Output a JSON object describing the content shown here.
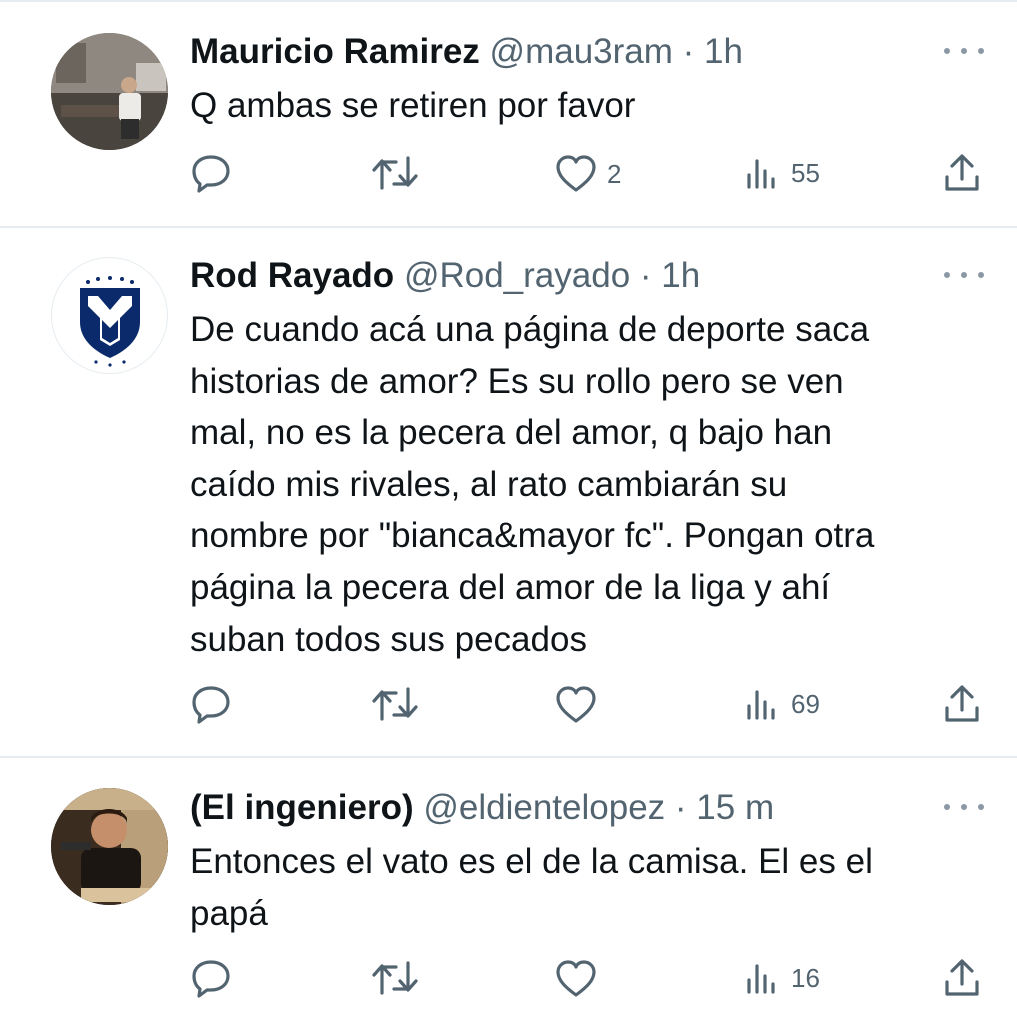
{
  "tweets": [
    {
      "author": {
        "name": "Mauricio Ramirez",
        "handle": "@mau3ram",
        "separator": "·",
        "time": "1h"
      },
      "text": "Q ambas se retiren por favor",
      "stats": {
        "replies": "",
        "retweets": "",
        "likes": "2",
        "views": "55"
      }
    },
    {
      "author": {
        "name": "Rod Rayado",
        "handle": "@Rod_rayado",
        "separator": "·",
        "time": "1h"
      },
      "text_lines": [
        "De cuando acá una página de deporte saca",
        "historias de amor? Es su rollo pero se ven",
        "mal, no es la pecera del amor, q bajo han",
        "caído mis rivales, al rato cambiarán su",
        "nombre por \"bianca&mayor fc\". Pongan otra",
        "página la pecera del amor de la liga y ahí",
        "suban todos sus pecados"
      ],
      "stats": {
        "replies": "",
        "retweets": "",
        "likes": "",
        "views": "69"
      }
    },
    {
      "author": {
        "name": "(El ingeniero)",
        "handle": "@eldientelopez",
        "separator": "·",
        "time": "15 m"
      },
      "text_lines": [
        "Entonces el vato es el de la camisa. El es el",
        "papá"
      ],
      "stats": {
        "replies": "",
        "retweets": "",
        "likes": "",
        "views": "16"
      }
    }
  ],
  "icons": {
    "reply": "reply-icon",
    "retweet": "retweet-icon",
    "like": "heart-icon",
    "views": "views-icon",
    "share": "share-icon",
    "more": "more-icon"
  },
  "colors": {
    "text": "#0f1419",
    "secondary": "#536471",
    "divider": "#e6ecf0",
    "team_blue": "#0a2a6b"
  }
}
